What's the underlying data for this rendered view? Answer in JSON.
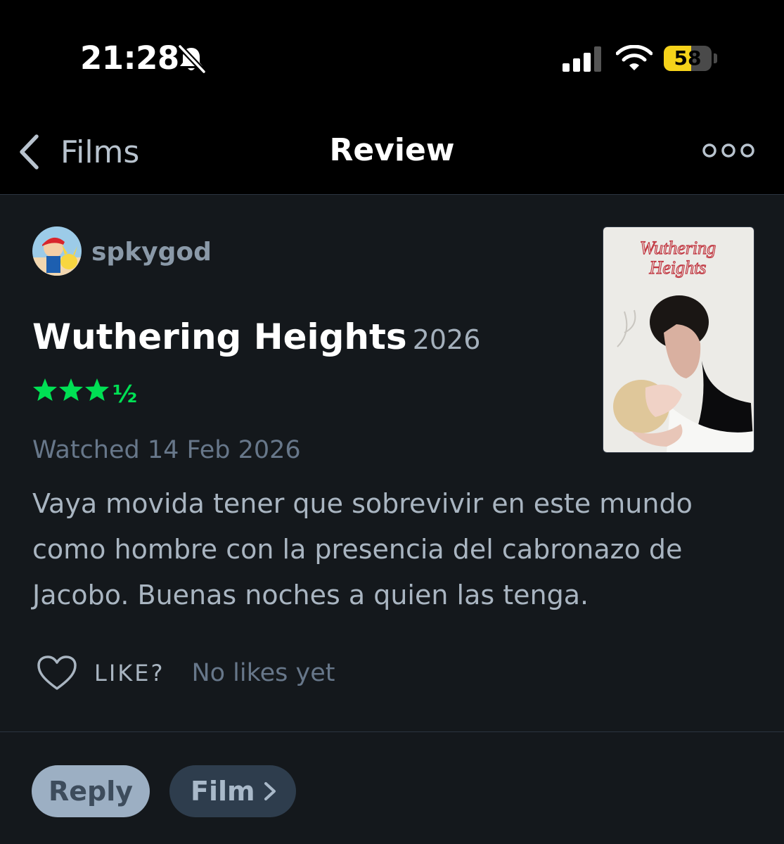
{
  "status_bar": {
    "time": "21:28",
    "battery": "58"
  },
  "nav": {
    "back_label": "Films",
    "title": "Review"
  },
  "review": {
    "username": "spkygod",
    "film_title": "Wuthering Heights",
    "film_year": "2026",
    "rating": 3.5,
    "rating_stars": "★★★½",
    "watched": "Watched 14 Feb 2026",
    "text": "Vaya movida tener que sobrevivir en este mundo como hombre con la presencia del cabronazo de Jacobo. Buenas noches a quien las tenga.",
    "poster_title": "Wuthering Heights"
  },
  "likes": {
    "label": "LIKE?",
    "count_text": "No likes yet"
  },
  "actions": {
    "reply_label": "Reply",
    "film_label": "Film"
  },
  "colors": {
    "background": "#14181c",
    "rating_green": "#00e054",
    "battery_yellow": "#f5d21a",
    "muted_text": "#67778a"
  },
  "icons": [
    "bell-slash-icon",
    "signal-icon",
    "wifi-icon",
    "battery-icon",
    "chevron-left-icon",
    "more-icon",
    "heart-icon",
    "chevron-right-icon"
  ]
}
